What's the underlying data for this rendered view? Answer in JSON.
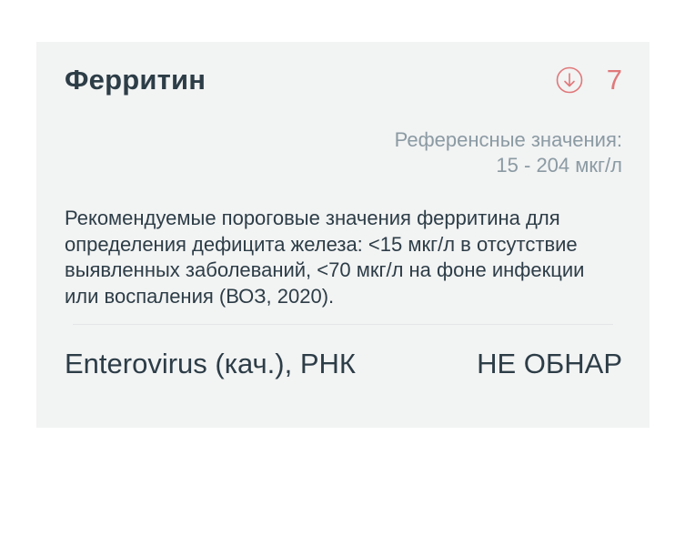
{
  "analytes": [
    {
      "name": "Ферритин",
      "value": "7",
      "flag_icon": "arrow-down-circle-icon",
      "reference_label": "Референсные значения:",
      "reference_range": "15 - 204 мкг/л",
      "note": "Рекомендуемые пороговые значения ферритина для определения дефицита железа: <15 мкг/л в отсутствие выявленных заболеваний, <70 мкг/л на фоне инфекции или воспаления (ВОЗ, 2020)."
    },
    {
      "name": "Enterovirus (кач.), РНК",
      "value": "НЕ ОБНАР"
    }
  ],
  "colors": {
    "card_background": "#f2f3f3",
    "text_primary": "#2d3d47",
    "text_secondary": "#8b9aa3",
    "low_value": "#e0787a"
  }
}
